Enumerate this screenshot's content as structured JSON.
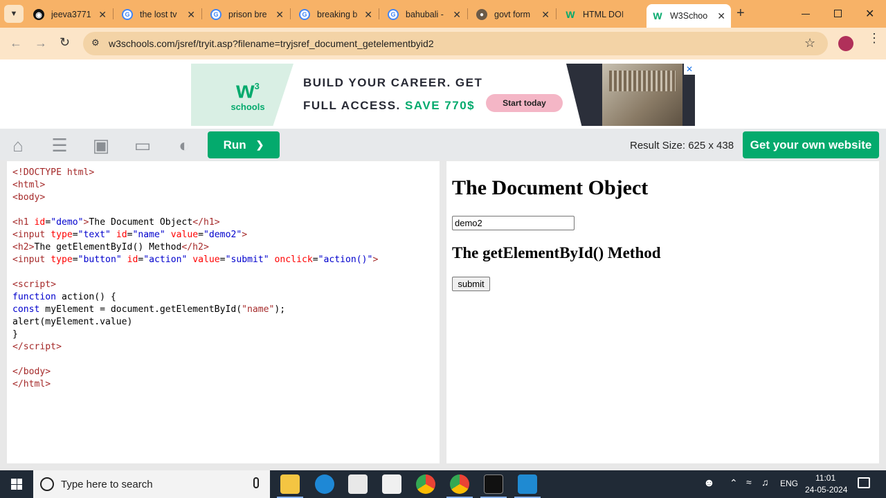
{
  "browser": {
    "tabs": [
      {
        "title": "jeeva3771",
        "icon": "github-icon"
      },
      {
        "title": "the lost tv",
        "icon": "google-icon"
      },
      {
        "title": "prison bre",
        "icon": "google-icon"
      },
      {
        "title": "breaking b",
        "icon": "google-icon"
      },
      {
        "title": "bahubali -",
        "icon": "google-icon"
      },
      {
        "title": "govt form",
        "icon": "globe-icon"
      },
      {
        "title": "HTML DOI",
        "icon": "w3schools-icon"
      },
      {
        "title": "W3Schoo",
        "icon": "w3schools-icon",
        "active": true
      }
    ],
    "url": "w3schools.com/jsref/tryit.asp?filename=tryjsref_document_getelementbyid2"
  },
  "ad": {
    "logo_top": "w",
    "logo_sup": "3",
    "logo_bottom": "schools",
    "line1": "BUILD YOUR CAREER. GET",
    "line2a": "FULL ACCESS.",
    "line2b": "SAVE 770$",
    "cta": "Start today",
    "close": "✕"
  },
  "w3bar": {
    "run_label": "Run",
    "run_chevron": "❯",
    "result_size": "Result Size: 625 x 438",
    "get_own": "Get your own website"
  },
  "result": {
    "h1": "The Document Object",
    "input_value": "demo2",
    "h2": "The getElementById() Method",
    "button_value": "submit"
  },
  "taskbar": {
    "search_placeholder": "Type here to search",
    "lang": "ENG",
    "time": "11:01",
    "date": "24-05-2024"
  },
  "colors": {
    "accent": "#04aa6d",
    "tabstrip": "#f7b267",
    "omnibox": "#f3d3a6"
  }
}
